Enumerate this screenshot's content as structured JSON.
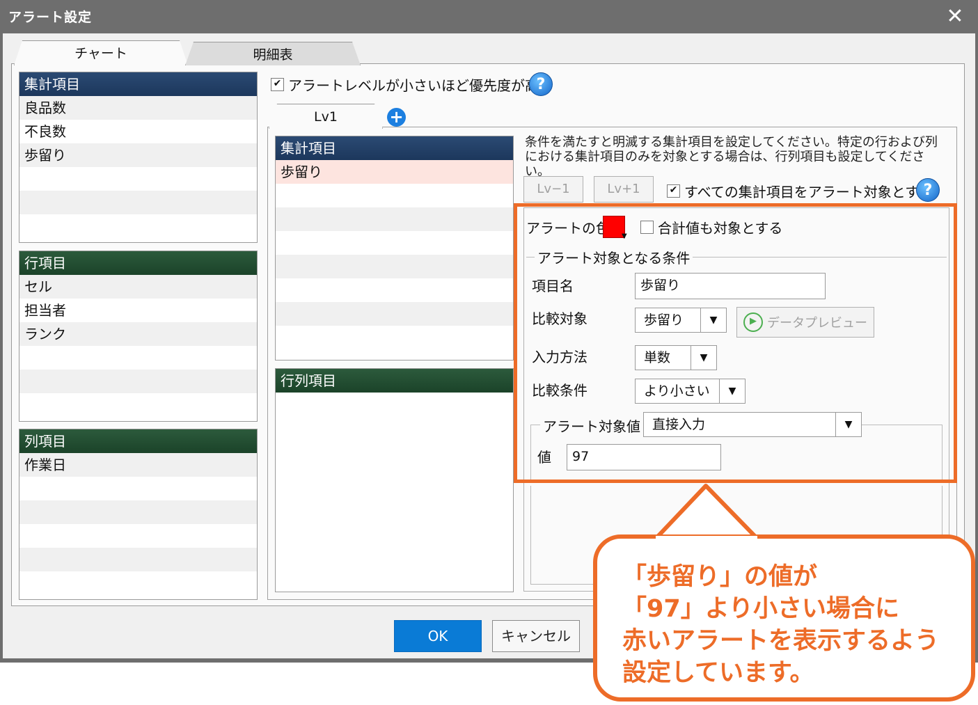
{
  "window": {
    "title": "アラート設定",
    "close_icon": "close-icon"
  },
  "tabs": [
    {
      "label": "チャート",
      "active": true
    },
    {
      "label": "明細表",
      "active": false
    }
  ],
  "left": {
    "summary": {
      "header": "集計項目",
      "items": [
        "良品数",
        "不良数",
        "歩留り"
      ]
    },
    "rows": {
      "header": "行項目",
      "items": [
        "セル",
        "担当者",
        "ランク"
      ]
    },
    "cols": {
      "header": "列項目",
      "items": [
        "作業日"
      ]
    }
  },
  "priority_checkbox": {
    "label": "アラートレベルが小さいほど優先度が高い",
    "checked": true
  },
  "level_tab": {
    "label": "Lv1",
    "add_icon": "plus-circle-icon"
  },
  "level_panel": {
    "summary_header": "集計項目",
    "summary_items": [
      "歩留り"
    ],
    "rowcol_header": "行列項目"
  },
  "instructions": "条件を満たすと明滅する集計項目を設定してください。特定の行および列における集計項目のみを対象とする場合は、行列項目も設定してください。",
  "buttons": {
    "lv_minus": "Lv−1",
    "lv_plus": "Lv+1",
    "ok": "OK",
    "cancel": "キャンセル"
  },
  "all_items_checkbox": {
    "label": "すべての集計項目をアラート対象とする",
    "checked": true
  },
  "alert": {
    "color_label": "アラートの色",
    "color_value": "#ff0000",
    "include_total_label": "合計値も対象とする",
    "include_total_checked": false,
    "condition_group": "アラート対象となる条件",
    "item_name_label": "項目名",
    "item_name_value": "歩留り",
    "compare_target_label": "比較対象",
    "compare_target_value": "歩留り",
    "data_preview": "データプレビュー",
    "input_method_label": "入力方法",
    "input_method_value": "単数",
    "compare_cond_label": "比較条件",
    "compare_cond_value": "より小さい",
    "target_value_group": "アラート対象値",
    "target_value_mode": "直接入力",
    "value_label": "値",
    "value": "97"
  },
  "callout": {
    "text": "「歩留り」の値が\n「97」より小さい場合に\n赤いアラートを表示するよう\n設定しています。",
    "color": "#ed6c28"
  }
}
